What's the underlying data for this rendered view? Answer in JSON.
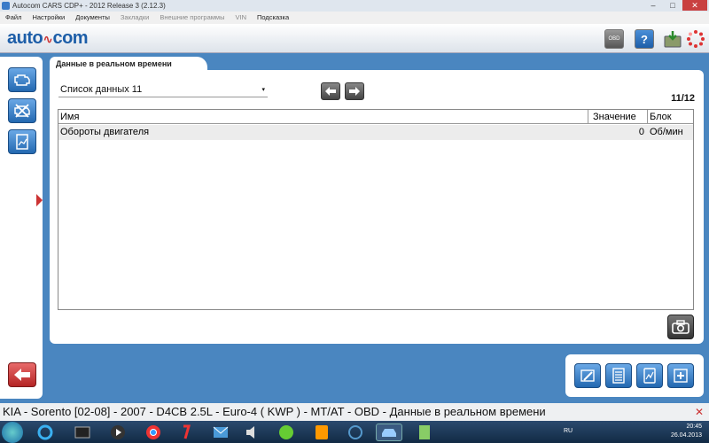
{
  "window": {
    "title": "Autocom CARS CDP+ - 2012 Release 3 (2.12.3)",
    "controls": {
      "minimize": "–",
      "maximize": "□",
      "close": "✕"
    }
  },
  "menu": {
    "items": [
      "Файл",
      "Настройки",
      "Документы",
      "Закладки",
      "Внешние программы",
      "VIN",
      "Подсказка"
    ]
  },
  "brand": {
    "logo_left": "auto",
    "logo_mid": "∿",
    "logo_right": "com"
  },
  "toolbar": {
    "obd_label": "OBD",
    "help_label": "?"
  },
  "tab": {
    "title": "Данные в реальном времени"
  },
  "dropdown": {
    "selected": "Список данных 11",
    "caret": "▾"
  },
  "counter": "11/12",
  "table": {
    "columns": {
      "name": "Имя",
      "value": "Значение",
      "unit": "Блок"
    },
    "rows": [
      {
        "name": "Обороты двигателя",
        "value": "0",
        "unit": "Об/мин"
      }
    ]
  },
  "status": {
    "vehicle": "KIA - Sorento [02-08] - 2007 - D4CB 2.5L - Euro-4 ( KWP ) - MT/AT - OBD - Данные в реальном времени",
    "close": "✕"
  },
  "taskbar": {
    "lang": "RU",
    "time": "20:45",
    "date": "26.04.2013"
  },
  "colors": {
    "background": "#4a86c0",
    "accent_blue": "#2368b0",
    "back_red": "#c33333"
  }
}
